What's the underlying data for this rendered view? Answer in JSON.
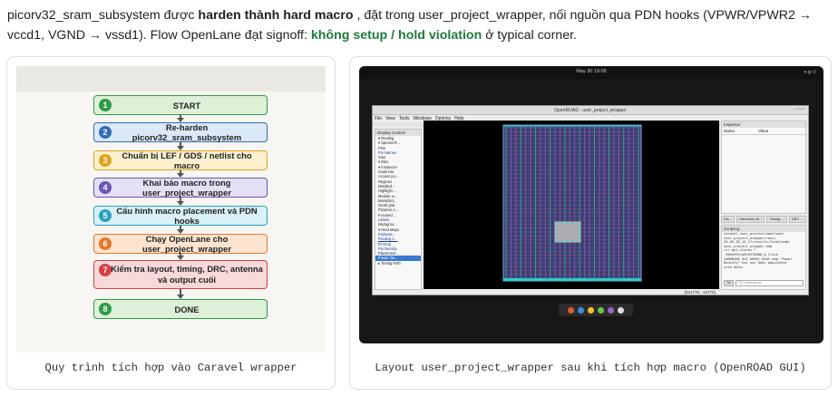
{
  "intro": {
    "p1": "picorv32_sram_subsystem được ",
    "b1": "harden thành hard macro",
    "p2": " , đặt trong user_project_wrapper, nối nguồn qua PDN hooks (VPWR/VPWR2 → vccd1, VGND → vssd1). Flow OpenLane đạt signoff: ",
    "g1": "không setup / hold violation",
    "p3": " ở typical corner."
  },
  "flow": {
    "steps": [
      {
        "num": "1",
        "label": "START",
        "color": "#2e9b47",
        "fill": "#dff0d8"
      },
      {
        "num": "2",
        "label": "Re-harden picorv32_sram_subsystem",
        "color": "#2f6db5",
        "fill": "#dbe8f7"
      },
      {
        "num": "3",
        "label": "Chuẩn bị LEF / GDS / netlist cho macro",
        "color": "#e0a21a",
        "fill": "#fdf0cf"
      },
      {
        "num": "4",
        "label": "Khai báo macro trong user_project_wrapper",
        "color": "#6a55b8",
        "fill": "#e6e0f4"
      },
      {
        "num": "5",
        "label": "Cấu hình macro placement và PDN hooks",
        "color": "#2aa3c2",
        "fill": "#d8f0f6"
      },
      {
        "num": "6",
        "label": "Chạy OpenLane cho user_project_wrapper",
        "color": "#e6782a",
        "fill": "#fde4d0"
      },
      {
        "num": "7",
        "label1": "Kiểm tra layout, timing, DRC, antenna",
        "label2": "và output cuối",
        "color": "#d63f45",
        "fill": "#f8d9da"
      },
      {
        "num": "8",
        "label": "DONE",
        "color": "#2e9b47",
        "fill": "#dff0d8"
      }
    ],
    "caption": "Quy trình tích hợp vào Caravel wrapper"
  },
  "shot": {
    "clock": "May 30  19:06",
    "title": "OpenROAD - user_project_wrapper",
    "menu": [
      "File",
      "View",
      "Tools",
      "Windows",
      "Options",
      "Help"
    ],
    "display_control": "Display Control",
    "tree": [
      {
        "t": "▾ Routing",
        "s": ""
      },
      {
        "t": "▾ Special R...",
        "s": ""
      },
      {
        "t": "   Pins",
        "s": ""
      },
      {
        "t": "   Pin Names",
        "s": "u"
      },
      {
        "t": "   Vias",
        "s": ""
      },
      {
        "t": "▾ Misc",
        "s": ""
      },
      {
        "t": "▾ Instances",
        "s": ""
      },
      {
        "t": "   Scale bar",
        "s": ""
      },
      {
        "t": "   Access po...",
        "s": ""
      },
      {
        "t": "   Regions",
        "s": ""
      },
      {
        "t": "   Detailed ...",
        "s": ""
      },
      {
        "t": "   Highlight ...",
        "s": ""
      },
      {
        "t": "   Module vi...",
        "s": ""
      },
      {
        "t": "   Manufact...",
        "s": ""
      },
      {
        "t": "   GCell grid",
        "s": ""
      },
      {
        "t": "   Flywires o...",
        "s": ""
      },
      {
        "t": "   Focused ...",
        "s": ""
      },
      {
        "t": "   Labels",
        "s": "u"
      },
      {
        "t": "   Backgrou...",
        "s": ""
      },
      {
        "t": "▾ Heat Maps",
        "s": ""
      },
      {
        "t": "   Estimate...",
        "s": "u"
      },
      {
        "t": "   Routing C...",
        "s": "u"
      },
      {
        "t": "   IR Drop",
        "s": "u"
      },
      {
        "t": "   Pin Density",
        "s": "u"
      },
      {
        "t": "   Placement...",
        "s": ""
      },
      {
        "t": "   Power De...",
        "s": "sel"
      },
      {
        "t": "▸ Timing Path",
        "s": ""
      }
    ],
    "inspector": "Inspector",
    "insp_name": "Name",
    "insp_value": "Value",
    "tabs": [
      "Dis...",
      "Hierarchy Br...",
      "Timing ...",
      "DRC ..."
    ],
    "scripting": "Scripting",
    "script_lines": [
      "caravel_user_project/openlane/",
      "user_project_wrapper/runs/",
      "26_05_30_14_17/results/final/odb/",
      "user_project_wrapper.odb",
      ">>> get_clocks *",
      "_00ee95fca0c0570000_p_Clock",
      "[WARNING GUI-0066] Heat map \"Power",
      "Density\" has not been populated",
      "with data."
    ],
    "script_btn": "Tcl",
    "script_placeholder": "TCL commands",
    "coords": "(621776, -14770)",
    "caption": "Layout user_project_wrapper sau khi tích hợp macro (OpenROAD GUI)"
  }
}
